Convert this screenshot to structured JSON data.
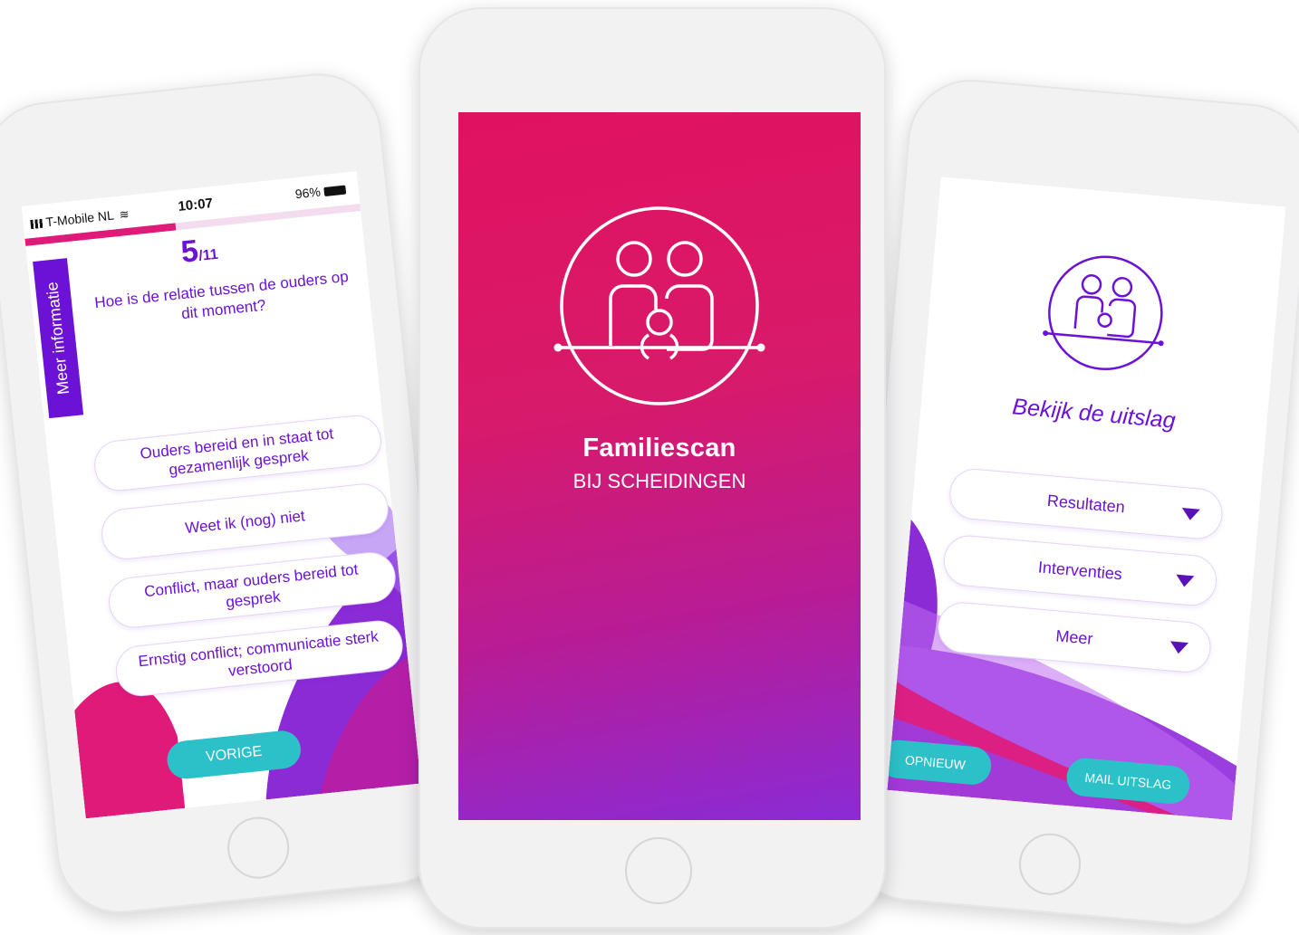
{
  "question_screen": {
    "status": {
      "carrier": "T-Mobile NL",
      "time": "10:07",
      "battery": "96%"
    },
    "progress": 0.45,
    "side_tab": "Meer informatie",
    "question_number": "5",
    "question_total": "/11",
    "question": "Hoe is de relatie tussen de ouders op dit moment?",
    "answers": [
      "Ouders bereid en in staat tot gezamenlijk gesprek",
      "Weet ik (nog) niet",
      "Conflict, maar ouders bereid tot gesprek",
      "Ernstig conflict; communicatie sterk verstoord"
    ],
    "back_button": "VORIGE"
  },
  "splash_screen": {
    "title": "Familiescan",
    "subtitle": "BIJ SCHEIDINGEN"
  },
  "result_screen": {
    "title": "Bekijk de uitslag",
    "dropdowns": [
      "Resultaten",
      "Interventies",
      "Meer"
    ],
    "restart_button": "OPNIEUW",
    "mail_button": "MAIL UITSLAG"
  },
  "colors": {
    "purple": "#6b12d6",
    "magenta": "#e0125f",
    "teal": "#2cc1c9"
  }
}
